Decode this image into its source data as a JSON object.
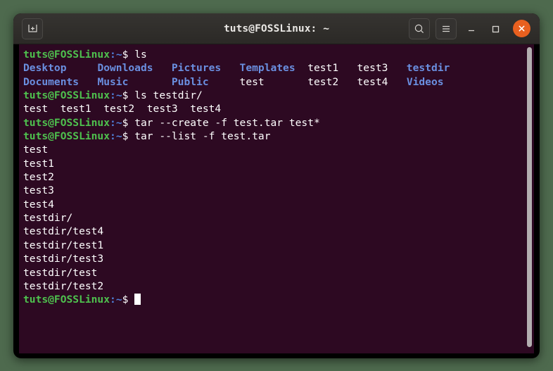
{
  "window": {
    "title": "tuts@FOSSLinux: ~",
    "titlebar": {
      "new_tab_icon": "new-tab-icon",
      "search_icon": "search-icon",
      "menu_icon": "hamburger-menu-icon",
      "minimize_icon": "minimize-icon",
      "maximize_icon": "maximize-icon",
      "close_icon": "close-icon"
    }
  },
  "colors": {
    "desktop_background": "#4e6a4e",
    "titlebar_background": "#302e2b",
    "terminal_background": "#2d0922",
    "close_button": "#e8601f",
    "prompt_user": "#4ec14e",
    "prompt_path": "#4f7fd8",
    "directory_text": "#6a8fe0",
    "file_text": "#ffffff",
    "scrollbar_thumb": "#b3aeb0"
  },
  "terminal": {
    "prompt": {
      "user_host": "tuts@FOSSLinux",
      "colon": ":",
      "path": "~",
      "sigil": "$"
    },
    "lines": [
      {
        "type": "prompt",
        "command": " ls"
      },
      {
        "type": "ls-row",
        "cells": [
          {
            "text": "Desktop",
            "kind": "dir",
            "width": 12
          },
          {
            "text": "Downloads",
            "kind": "dir",
            "width": 12
          },
          {
            "text": "Pictures",
            "kind": "dir",
            "width": 11
          },
          {
            "text": "Templates",
            "kind": "dir",
            "width": 11
          },
          {
            "text": "test1",
            "kind": "file",
            "width": 8
          },
          {
            "text": "test3",
            "kind": "file",
            "width": 8
          },
          {
            "text": "testdir",
            "kind": "dir",
            "width": 7
          }
        ]
      },
      {
        "type": "ls-row",
        "cells": [
          {
            "text": "Documents",
            "kind": "dir",
            "width": 12
          },
          {
            "text": "Music",
            "kind": "dir",
            "width": 12
          },
          {
            "text": "Public",
            "kind": "dir",
            "width": 11
          },
          {
            "text": "test",
            "kind": "file",
            "width": 11
          },
          {
            "text": "test2",
            "kind": "file",
            "width": 8
          },
          {
            "text": "test4",
            "kind": "file",
            "width": 8
          },
          {
            "text": "Videos",
            "kind": "dir",
            "width": 6
          }
        ]
      },
      {
        "type": "prompt",
        "command": " ls testdir/"
      },
      {
        "type": "ls-row",
        "cells": [
          {
            "text": "test",
            "kind": "file",
            "width": 6
          },
          {
            "text": "test1",
            "kind": "file",
            "width": 7
          },
          {
            "text": "test2",
            "kind": "file",
            "width": 7
          },
          {
            "text": "test3",
            "kind": "file",
            "width": 7
          },
          {
            "text": "test4",
            "kind": "file",
            "width": 5
          }
        ]
      },
      {
        "type": "prompt",
        "command": " tar --create -f test.tar test*"
      },
      {
        "type": "prompt",
        "command": " tar --list -f test.tar"
      },
      {
        "type": "output",
        "text": "test"
      },
      {
        "type": "output",
        "text": "test1"
      },
      {
        "type": "output",
        "text": "test2"
      },
      {
        "type": "output",
        "text": "test3"
      },
      {
        "type": "output",
        "text": "test4"
      },
      {
        "type": "output",
        "text": "testdir/"
      },
      {
        "type": "output",
        "text": "testdir/test4"
      },
      {
        "type": "output",
        "text": "testdir/test1"
      },
      {
        "type": "output",
        "text": "testdir/test3"
      },
      {
        "type": "output",
        "text": "testdir/test"
      },
      {
        "type": "output",
        "text": "testdir/test2"
      },
      {
        "type": "prompt",
        "command": " ",
        "cursor": true
      }
    ]
  }
}
